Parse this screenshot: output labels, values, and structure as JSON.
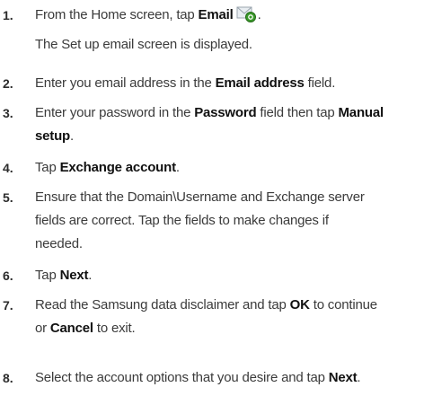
{
  "steps": [
    {
      "num": "1.",
      "before": "From the Home screen, tap ",
      "bold": "Email",
      "after": "",
      "icon": "email-app-icon"
    },
    {
      "sub": "The Set up email screen is displayed."
    },
    {
      "num": "2.",
      "l1a": "Enter you email address in the ",
      "l1b": "Email address",
      "l1c": " field."
    },
    {
      "num": "3.",
      "l1a": "Enter your password in the ",
      "l1b": "Password",
      "l1c": " field then tap ",
      "l1d": "Manual",
      "l2": "setup",
      "l2end": "."
    },
    {
      "num": "4.",
      "a": "Tap ",
      "b": "Exchange account",
      "c": "."
    },
    {
      "num": "5.",
      "line1": "Ensure that the Domain\\Username and Exchange server",
      "line2": "fields are correct. Tap the fields to make changes if",
      "line3": "needed."
    },
    {
      "num": "6.",
      "a": "Tap ",
      "b": "Next",
      "c": "."
    },
    {
      "num": "7.",
      "l1a": "Read the Samsung data disclaimer and tap ",
      "l1b": "OK",
      "l1c": " to continue",
      "l2a": "or ",
      "l2b": "Cancel",
      "l2c": " to exit."
    },
    {
      "num": "8.",
      "a": "Select the account options that you desire and tap ",
      "b": "Next",
      "c": "."
    }
  ],
  "colors": {
    "text": "#3b3b3b",
    "bold": "#111111",
    "icon_green": "#3a9a2a"
  }
}
